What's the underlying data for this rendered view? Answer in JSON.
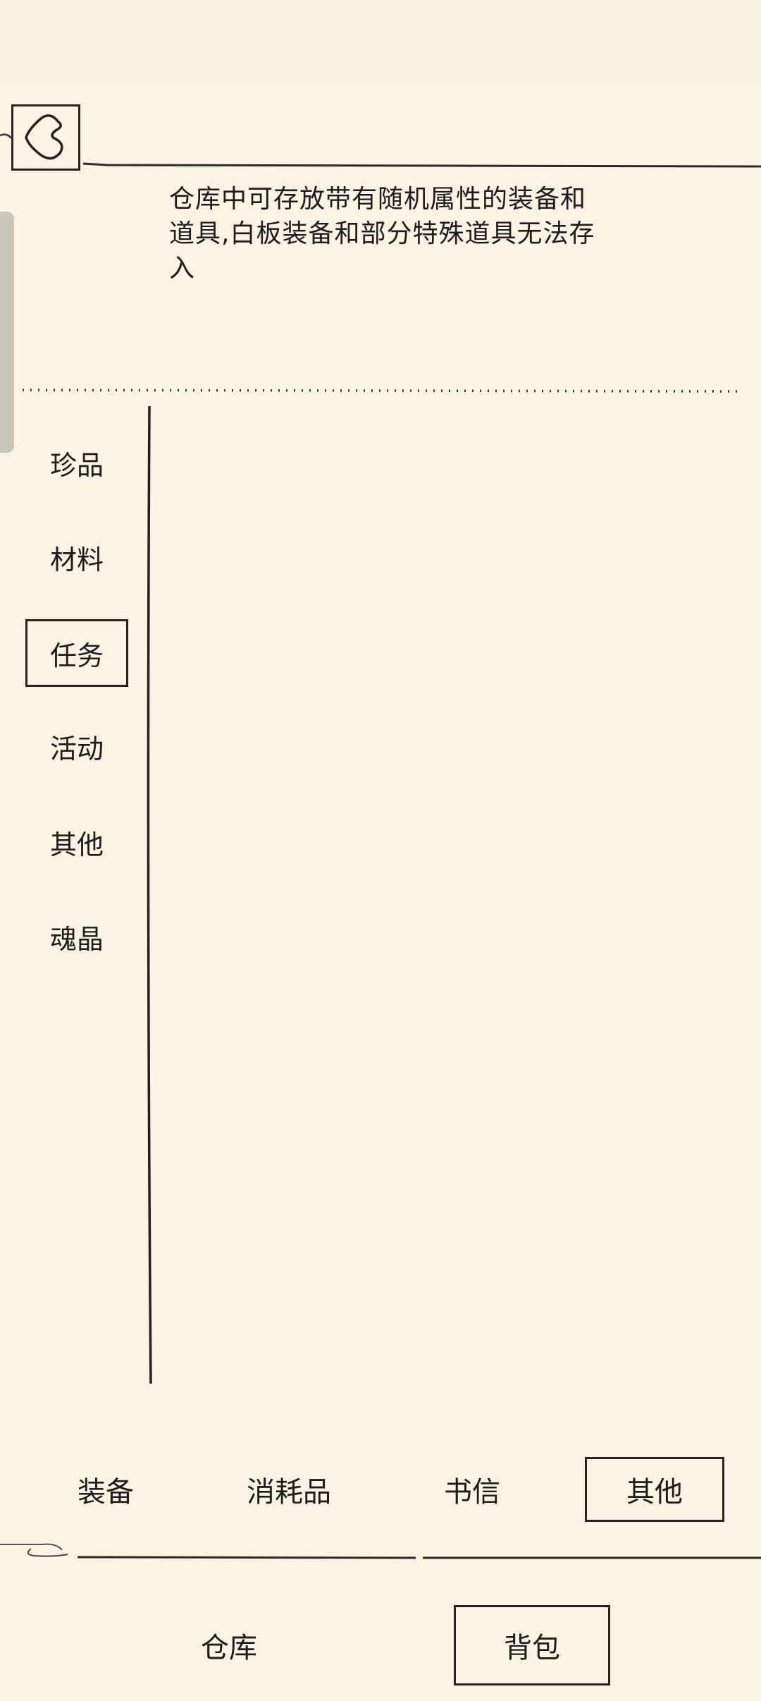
{
  "header": {
    "back_icon": "back-arrow-icon",
    "description": "仓库中可存放带有随机属性的装备和道具,白板装备和部分特殊道具无法存入"
  },
  "categories": [
    {
      "label": "珍品",
      "active": false
    },
    {
      "label": "材料",
      "active": false
    },
    {
      "label": "任务",
      "active": true
    },
    {
      "label": "活动",
      "active": false
    },
    {
      "label": "其他",
      "active": false
    },
    {
      "label": "魂晶",
      "active": false
    }
  ],
  "item_tabs": [
    {
      "label": "装备",
      "active": false
    },
    {
      "label": "消耗品",
      "active": false
    },
    {
      "label": "书信",
      "active": false
    },
    {
      "label": "其他",
      "active": true
    }
  ],
  "footer_tabs": [
    {
      "label": "仓库",
      "active": false
    },
    {
      "label": "背包",
      "active": true
    }
  ],
  "colors": {
    "background": "#fbf4e4",
    "ink": "#1c1c1c"
  }
}
